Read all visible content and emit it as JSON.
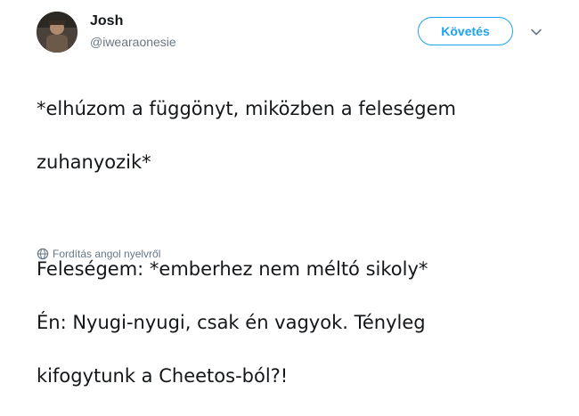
{
  "author": {
    "display_name": "Josh",
    "handle": "@iwearaonesie"
  },
  "follow_button": {
    "label": "Követés"
  },
  "tweet": {
    "line1": "*elhúzom a függönyt, miközben a feleségem",
    "line2": "zuhanyozik*",
    "line3": "Feleségem: *emberhez nem méltó sikoly*",
    "line4": "Én: Nyugi-nyugi, csak én vagyok. Tényleg",
    "line5": "kifogytunk a Cheetos-ból?!"
  },
  "translate": {
    "label": "Fordítás angol nyelvről",
    "icon": "globe-icon"
  },
  "colors": {
    "accent": "#1da1f2",
    "secondary_text": "#657786",
    "primary_text": "#14171a"
  }
}
